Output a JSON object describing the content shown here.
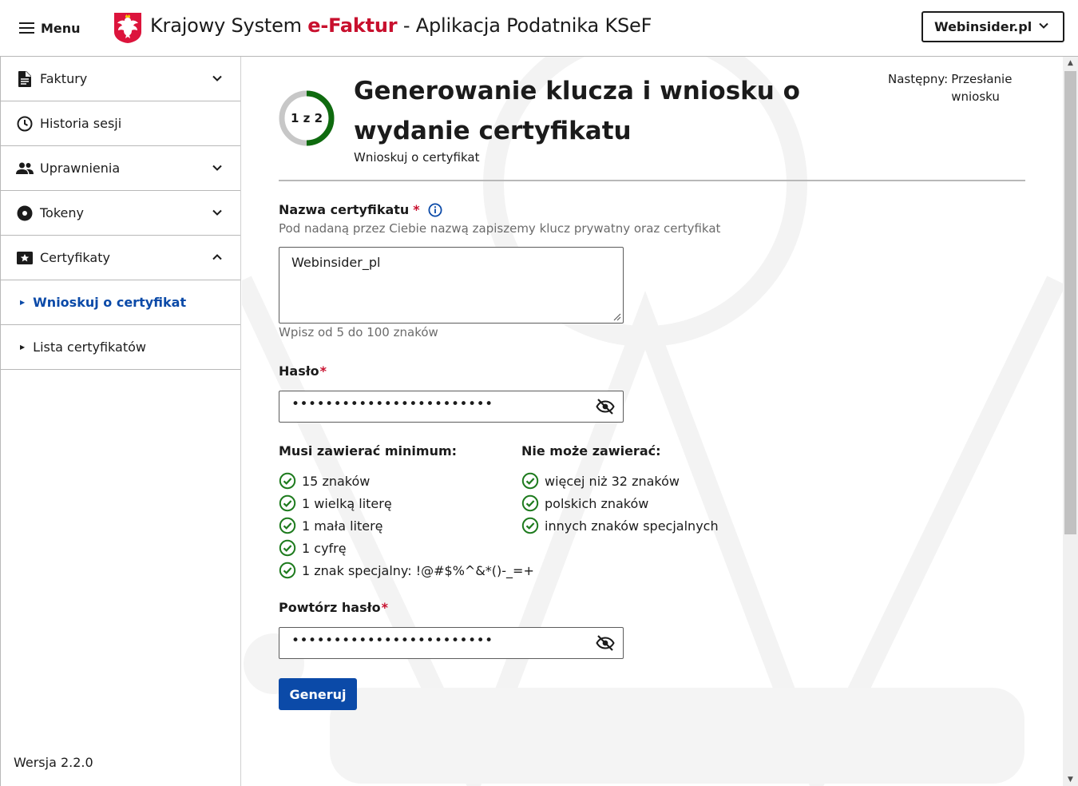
{
  "header": {
    "menu_label": "Menu",
    "title_prefix": "Krajowy System ",
    "title_accent": "e-Faktur",
    "title_suffix": " - Aplikacja Podatnika KSeF",
    "account_label": "Webinsider.pl"
  },
  "sidebar": {
    "items": [
      {
        "label": "Faktury",
        "icon": "document-icon",
        "expanded": false
      },
      {
        "label": "Historia sesji",
        "icon": "clock-icon"
      },
      {
        "label": "Uprawnienia",
        "icon": "people-icon",
        "expanded": false
      },
      {
        "label": "Tokeny",
        "icon": "disc-icon",
        "expanded": false
      },
      {
        "label": "Certyfikaty",
        "icon": "certificate-icon",
        "expanded": true
      }
    ],
    "subitems": [
      {
        "label": "Wnioskuj o certyfikat",
        "active": true
      },
      {
        "label": "Lista certyfikatów",
        "active": false
      }
    ],
    "version": "Wersja 2.2.0"
  },
  "stepper": {
    "step_label": "1 z 2",
    "progress": 0.5,
    "title": "Generowanie klucza i wniosku o wydanie certyfikatu",
    "subtitle": "Wnioskuj o certyfikat",
    "next_label": "Następny:",
    "next_value": "Przesłanie wniosku"
  },
  "form": {
    "cert_name": {
      "label": "Nazwa certyfikatu",
      "required_mark": "*",
      "description": "Pod nadaną przez Ciebie nazwą zapiszemy klucz prywatny oraz certyfikat",
      "value": "Webinsider_pl",
      "hint": "Wpisz od 5 do 100 znaków"
    },
    "password": {
      "label": "Hasło",
      "required_mark": "*",
      "masked_value": "••••••••••••••••••••••••"
    },
    "rules": {
      "must_title": "Musi zawierać minimum:",
      "must": [
        "15 znaków",
        "1 wielką literę",
        "1 mała literę",
        "1 cyfrę",
        "1 znak specjalny: !@#$%^&*()-_=+"
      ],
      "cannot_title": "Nie może zawierać:",
      "cannot": [
        "więcej niż 32 znaków",
        "polskich znaków",
        "innych znaków specjalnych"
      ]
    },
    "password_repeat": {
      "label": "Powtórz hasło",
      "required_mark": "*",
      "masked_value": "••••••••••••••••••••••••"
    },
    "submit_label": "Generuj"
  },
  "colors": {
    "primary": "#0b4aa8",
    "required": "#c8102e",
    "success": "#1e7b1e",
    "step_ring": "#0f6b0f"
  }
}
